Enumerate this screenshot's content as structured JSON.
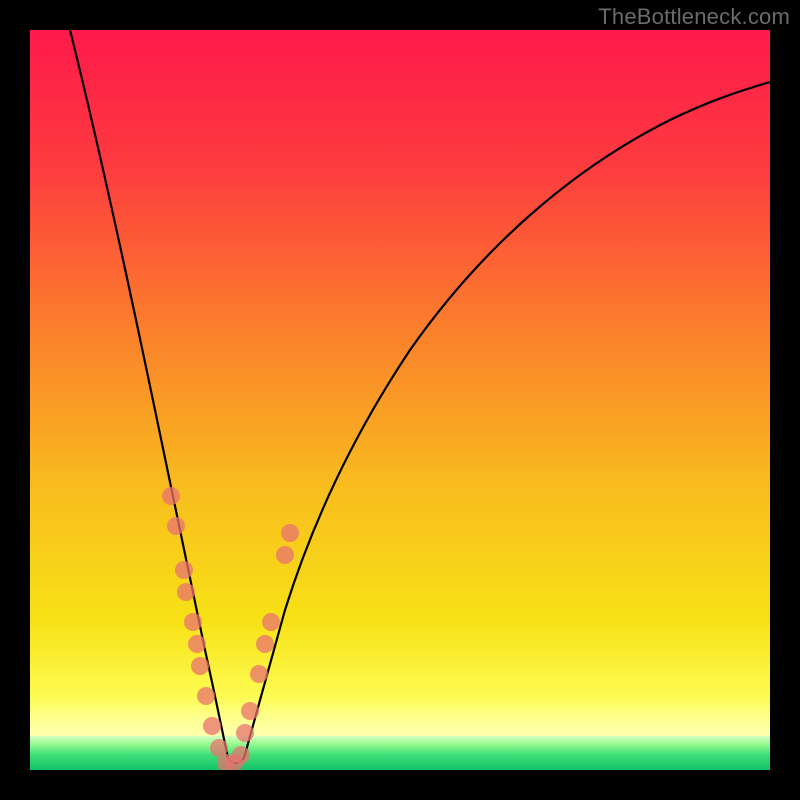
{
  "watermark": "TheBottleneck.com",
  "colors": {
    "gradient_top": "#fe1a4b",
    "gradient_mid": "#f7d318",
    "gradient_low_yellow": "#feff86",
    "gradient_green_light": "#93fa8e",
    "gradient_green_dark": "#12c267",
    "curve_stroke": "#000000",
    "marker_fill": "#e8736f",
    "background": "#000000",
    "watermark_color": "#6b6b6b"
  },
  "chart_data": {
    "type": "line",
    "title": "",
    "xlabel": "",
    "ylabel": "",
    "xlim": [
      0,
      100
    ],
    "ylim": [
      0,
      100
    ],
    "grid": false,
    "legend": false,
    "notes": "Axes carry no visible tick labels in the source image; x and y are normalized 0–100. Values are read off the rendered curves (y = 0 at bottom, 100 at top). Curve reaches ~0 (green zone) near x≈26–28, forming a V.",
    "series": [
      {
        "name": "bottleneck-curve",
        "x": [
          5,
          8,
          11,
          14,
          17,
          19,
          21,
          23,
          25,
          26,
          27,
          28,
          29,
          31,
          33,
          35,
          38,
          42,
          48,
          55,
          63,
          72,
          82,
          92,
          100
        ],
        "values": [
          100,
          87,
          74,
          61,
          48,
          39,
          30,
          20,
          10,
          5,
          1,
          1,
          5,
          13,
          22,
          30,
          40,
          50,
          60,
          68,
          75,
          81,
          86,
          90,
          93
        ]
      }
    ],
    "markers": {
      "name": "sample-dots",
      "note": "Pink/coral circular markers clustered along the V near the trough.",
      "points": [
        {
          "x": 19.0,
          "y": 37
        },
        {
          "x": 19.7,
          "y": 33
        },
        {
          "x": 20.8,
          "y": 27
        },
        {
          "x": 21.1,
          "y": 24
        },
        {
          "x": 22.0,
          "y": 20
        },
        {
          "x": 22.6,
          "y": 17
        },
        {
          "x": 23.0,
          "y": 14
        },
        {
          "x": 23.8,
          "y": 10
        },
        {
          "x": 24.6,
          "y": 6
        },
        {
          "x": 25.5,
          "y": 3
        },
        {
          "x": 26.5,
          "y": 1
        },
        {
          "x": 27.5,
          "y": 1
        },
        {
          "x": 28.5,
          "y": 2
        },
        {
          "x": 29.0,
          "y": 5
        },
        {
          "x": 29.7,
          "y": 8
        },
        {
          "x": 31.0,
          "y": 13
        },
        {
          "x": 31.8,
          "y": 17
        },
        {
          "x": 32.6,
          "y": 20
        },
        {
          "x": 34.5,
          "y": 29
        },
        {
          "x": 35.1,
          "y": 32
        }
      ],
      "radius_px": 9
    },
    "color_bands": [
      {
        "name": "red-orange-yellow-gradient",
        "y_from": 8,
        "y_to": 100
      },
      {
        "name": "pale-yellow-band",
        "y_from": 4,
        "y_to": 8
      },
      {
        "name": "green-gradient-band",
        "y_from": 0,
        "y_to": 4
      }
    ]
  }
}
